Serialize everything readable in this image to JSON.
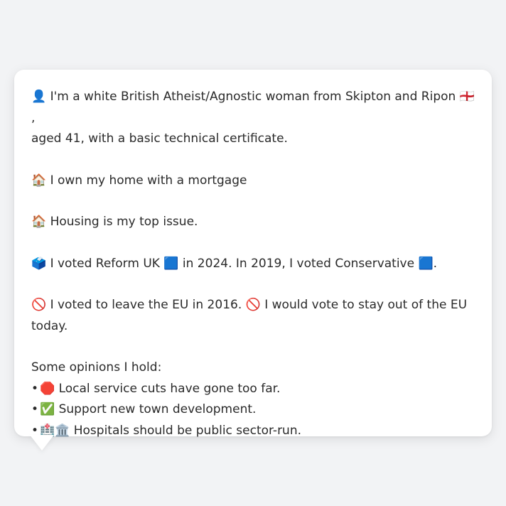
{
  "bio": {
    "identity_icon": "👤",
    "identity_text": "I'm a white British Atheist/Agnostic woman from Skipton and Ripon",
    "flag_icon": "🏴󠁧󠁢󠁥󠁮󠁧󠁿",
    "identity_suffix": ",",
    "identity_line2": "aged 41, with a basic technical certificate.",
    "home_icon": "🏠",
    "home_text": "I own my home with a mortgage",
    "issue_icon": "🏠",
    "issue_text": "Housing is my top issue.",
    "vote_icon": "🗳️",
    "vote_text_1": "I voted Reform UK",
    "vote_square_1": "🟦",
    "vote_text_2": "in 2024. In 2019, I voted Conservative",
    "vote_square_2": "🟦",
    "vote_text_3": ".",
    "eu_icon_1": "🚫",
    "eu_text_1": "I voted to leave the EU in 2016.",
    "eu_icon_2": "🚫",
    "eu_text_2": "I would vote to stay out of the EU",
    "eu_text_3": "today.",
    "opinions_heading": "Some opinions I hold:",
    "opinions": [
      {
        "bullet": "•",
        "icon": "🛑",
        "text": "Local service cuts have gone too far."
      },
      {
        "bullet": "•",
        "icon": "✅",
        "text": "Support new town development."
      },
      {
        "bullet": "•",
        "icon": "🏥🏛️",
        "text": "Hospitals should be public sector-run."
      }
    ]
  }
}
